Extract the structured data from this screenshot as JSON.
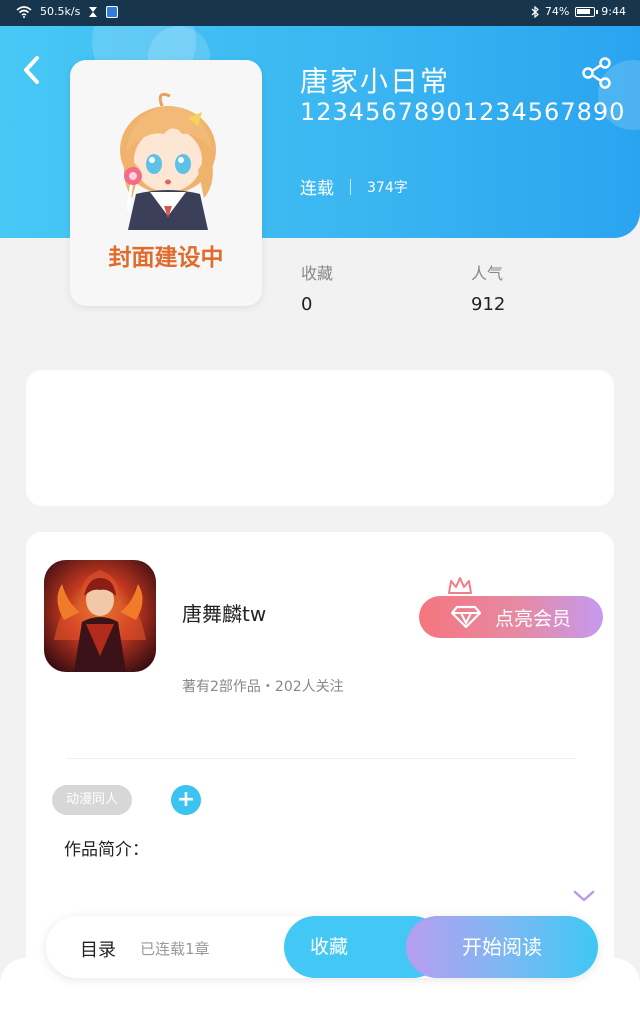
{
  "status_bar": {
    "network_speed": "50.5k/s",
    "battery": "74%",
    "time": "9:44"
  },
  "book": {
    "title": "唐家小日常",
    "subtitle": "12345678901234567890",
    "status": "连载",
    "word_count": "374字",
    "cover_text": "封面建设中"
  },
  "stats": {
    "favorites_label": "收藏",
    "favorites_value": "0",
    "popularity_label": "人气",
    "popularity_value": "912"
  },
  "author": {
    "name": "唐舞麟tw",
    "stats": "著有2部作品・202人关注",
    "vip_button": "点亮会员"
  },
  "tags": [
    "动漫同人"
  ],
  "intro_label": "作品简介：",
  "bottom_bar": {
    "toc_label": "目录",
    "toc_status": "已连载1章",
    "collect_label": "收藏",
    "read_label": "开始阅读"
  },
  "colors": {
    "header_blue": "#3bb6f1",
    "accent_blue": "#43c7f4",
    "vip_pink": "#f5767e",
    "vip_purple": "#c59af0",
    "cover_orange": "#e06b2a"
  },
  "icons": [
    "wifi-icon",
    "hourglass-icon",
    "bluetooth-icon",
    "battery-icon",
    "back-arrow-icon",
    "share-icon",
    "crown-icon",
    "diamond-icon",
    "plus-icon",
    "chevron-down-icon"
  ]
}
